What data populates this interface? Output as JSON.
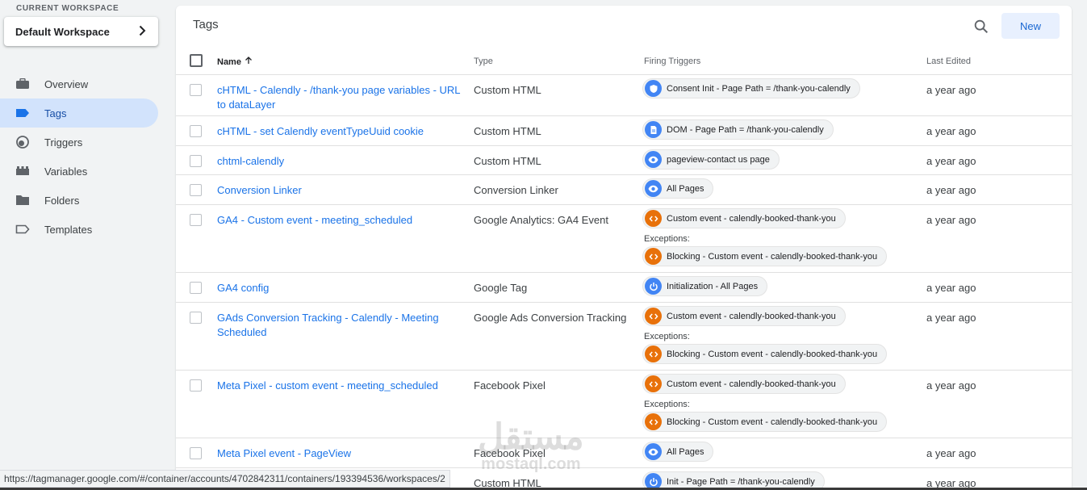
{
  "workspace": {
    "label": "CURRENT WORKSPACE",
    "name": "Default Workspace"
  },
  "nav": [
    {
      "label": "Overview",
      "icon": "briefcase-icon"
    },
    {
      "label": "Tags",
      "icon": "tag-icon",
      "active": true
    },
    {
      "label": "Triggers",
      "icon": "trigger-icon"
    },
    {
      "label": "Variables",
      "icon": "variables-icon"
    },
    {
      "label": "Folders",
      "icon": "folder-icon"
    },
    {
      "label": "Templates",
      "icon": "template-icon"
    }
  ],
  "panel": {
    "title": "Tags",
    "new_label": "New"
  },
  "columns": {
    "name": "Name",
    "type": "Type",
    "triggers": "Firing Triggers",
    "edited": "Last Edited"
  },
  "exceptions_label": "Exceptions:",
  "rows": [
    {
      "name": "cHTML - Calendly - /thank-you page variables - URL to dataLayer",
      "type": "Custom HTML",
      "edited": "a year ago",
      "triggers": [
        {
          "label": "Consent Init - Page Path = /thank-you-calendly",
          "icon": "shield-icon",
          "color": "blue"
        }
      ]
    },
    {
      "name": "cHTML - set Calendly eventTypeUuid cookie",
      "type": "Custom HTML",
      "edited": "a year ago",
      "triggers": [
        {
          "label": "DOM - Page Path = /thank-you-calendly",
          "icon": "document-icon",
          "color": "blue"
        }
      ]
    },
    {
      "name": "chtml-calendly",
      "type": "Custom HTML",
      "edited": "a year ago",
      "triggers": [
        {
          "label": "pageview-contact us page",
          "icon": "eye-icon",
          "color": "blue"
        }
      ]
    },
    {
      "name": "Conversion Linker",
      "type": "Conversion Linker",
      "edited": "a year ago",
      "triggers": [
        {
          "label": "All Pages",
          "icon": "eye-icon",
          "color": "blue"
        }
      ]
    },
    {
      "name": "GA4 - Custom event - meeting_scheduled",
      "type": "Google Analytics: GA4 Event",
      "edited": "a year ago",
      "triggers": [
        {
          "label": "Custom event - calendly-booked-thank-you",
          "icon": "code-icon",
          "color": "orange"
        }
      ],
      "exceptions": [
        {
          "label": "Blocking - Custom event - calendly-booked-thank-you",
          "icon": "code-icon",
          "color": "orange"
        }
      ]
    },
    {
      "name": "GA4 config",
      "type": "Google Tag",
      "edited": "a year ago",
      "triggers": [
        {
          "label": "Initialization - All Pages",
          "icon": "power-icon",
          "color": "blue"
        }
      ]
    },
    {
      "name": "GAds Conversion Tracking - Calendly - Meeting Scheduled",
      "type": "Google Ads Conversion Tracking",
      "edited": "a year ago",
      "triggers": [
        {
          "label": "Custom event - calendly-booked-thank-you",
          "icon": "code-icon",
          "color": "orange"
        }
      ],
      "exceptions": [
        {
          "label": "Blocking - Custom event - calendly-booked-thank-you",
          "icon": "code-icon",
          "color": "orange"
        }
      ]
    },
    {
      "name": "Meta Pixel - custom event - meeting_scheduled",
      "type": "Facebook Pixel",
      "edited": "a year ago",
      "triggers": [
        {
          "label": "Custom event - calendly-booked-thank-you",
          "icon": "code-icon",
          "color": "orange"
        }
      ],
      "exceptions": [
        {
          "label": "Blocking - Custom event - calendly-booked-thank-you",
          "icon": "code-icon",
          "color": "orange"
        }
      ]
    },
    {
      "name": "Meta Pixel event - PageView",
      "type": "Facebook Pixel",
      "edited": "a year ago",
      "triggers": [
        {
          "label": "All Pages",
          "icon": "eye-icon",
          "color": "blue"
        }
      ]
    },
    {
      "name": "",
      "type": "Custom HTML",
      "edited": "a year ago",
      "triggers": [
        {
          "label": "Init - Page Path = /thank-you-calendly",
          "icon": "power-icon",
          "color": "blue"
        }
      ]
    }
  ],
  "status_url": "https://tagmanager.google.com/#/container/accounts/4702842311/containers/193394536/workspaces/2",
  "watermark": {
    "arabic": "مستقل",
    "latin": "mostaql.com"
  }
}
